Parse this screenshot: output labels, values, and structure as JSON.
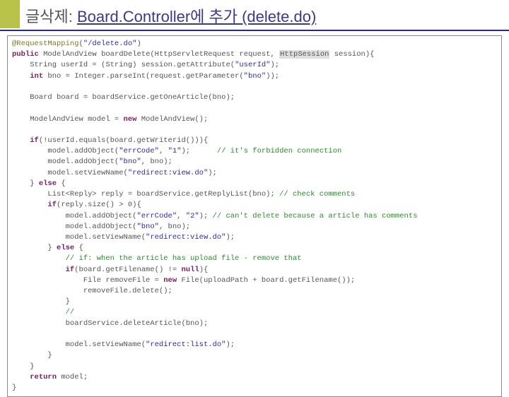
{
  "title": {
    "part1": "글삭제:",
    "part2": "Board.Controller에 추가 (delete.do)"
  },
  "code": {
    "l01_ann": "@RequestMapping",
    "l01_annarg": "\"/delete.do\"",
    "l02_kw_pub": "public",
    "l02_ret": "ModelAndView",
    "l02_fn": "boardDelete(HttpServletRequest request, ",
    "l02_hi": "HttpSession",
    "l02_tail": " session){",
    "l03_a": "    String userId = (String) session.getAttribute(",
    "l03_s": "\"userId\"",
    "l03_b": ");",
    "l04_kw_int": "int",
    "l04_a": " bno = Integer.parseInt(request.getParameter(",
    "l04_s": "\"bno\"",
    "l04_b": "));",
    "l06": "    Board board = boardService.getOneArticle(bno);",
    "l08_a": "    ModelAndView model = ",
    "l08_kw_new": "new",
    "l08_b": " ModelAndView();",
    "l10_kw_if": "if",
    "l10_a": "(!userId.equals(board.getWriterid())){",
    "l11_a": "        model.addObject(",
    "l11_s1": "\"errCode\"",
    "l11_m": ", ",
    "l11_s2": "\"1\"",
    "l11_b": ");      ",
    "l11_cmt": "// it's forbidden connection",
    "l12_a": "        model.addObject(",
    "l12_s": "\"bno\"",
    "l12_b": ", bno);",
    "l13_a": "        model.setViewName(",
    "l13_s": "\"redirect:view.do\"",
    "l13_b": ");",
    "l14_a": "    } ",
    "l14_kw_else": "else",
    "l14_b": " {",
    "l15_a": "        List<Reply> reply = boardService.getReplyList(bno); ",
    "l15_cmt": "// check comments",
    "l16_kw_if": "if",
    "l16_a": "(reply.size() > 0){",
    "l17_a": "            model.addObject(",
    "l17_s1": "\"errCode\"",
    "l17_m": ", ",
    "l17_s2": "\"2\"",
    "l17_b": "); ",
    "l17_cmt": "// can't delete because a article has comments",
    "l18_a": "            model.addObject(",
    "l18_s": "\"bno\"",
    "l18_b": ", bno);",
    "l19_a": "            model.setViewName(",
    "l19_s": "\"redirect:view.do\"",
    "l19_b": ");",
    "l20_a": "        } ",
    "l20_kw_else": "else",
    "l20_b": " {",
    "l21_cmt": "            // if: when the article has upload file - remove that",
    "l22_kw_if": "if",
    "l22_a": "(board.getFilename() != ",
    "l22_kw_null": "null",
    "l22_b": "){",
    "l23_a": "                File removeFile = ",
    "l23_kw_new": "new",
    "l23_b": " File(uploadPath + board.getFilename());",
    "l24": "                removeFile.delete();",
    "l25": "            }",
    "l26_cmt": "            //",
    "l27": "            boardService.deleteArticle(bno);",
    "l29_a": "            model.setViewName(",
    "l29_s": "\"redirect:list.do\"",
    "l29_b": ");",
    "l30": "        }",
    "l31": "    }",
    "l32_kw_ret": "return",
    "l32_a": " model;",
    "l33": "}"
  }
}
